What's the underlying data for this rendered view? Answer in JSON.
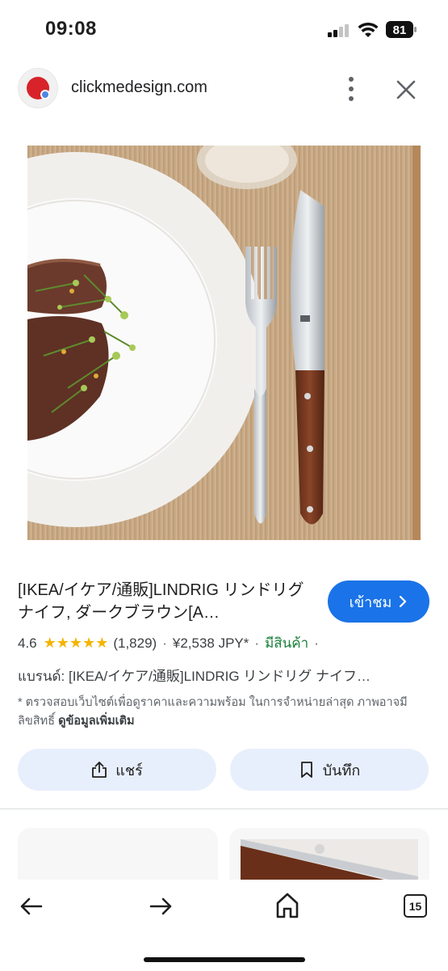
{
  "status_bar": {
    "time": "09:08",
    "battery": "81"
  },
  "browser": {
    "domain": "clickmedesign.com"
  },
  "product": {
    "title": "[IKEA/イケア/通販]LINDRIG リンドリグ ナイフ, ダークブラウン[A…",
    "visit_label": "เข้าชม",
    "rating": "4.6",
    "stars": "★★★★★",
    "review_count": "(1,829)",
    "price": "¥2,538 JPY*",
    "stock": "มีสินค้า",
    "brand": "แบรนด์: [IKEA/イケア/通販]LINDRIG リンドリグ ナイフ…",
    "disclaimer": "* ตรวจสอบเว็บไซต์เพื่อดูราคาและความพร้อม ในการจำหน่ายล่าสุด ภาพอาจมีลิขสิทธิ์",
    "learn_more": "ดูข้อมูลเพิ่มเติม"
  },
  "actions": {
    "share_label": "แชร์",
    "save_label": "บันทึก"
  },
  "bottom_nav": {
    "tab_count": "15"
  },
  "colors": {
    "accent": "#1a73e8",
    "stock_green": "#188038",
    "star": "#f4b400",
    "action_bg": "#e8effc"
  }
}
